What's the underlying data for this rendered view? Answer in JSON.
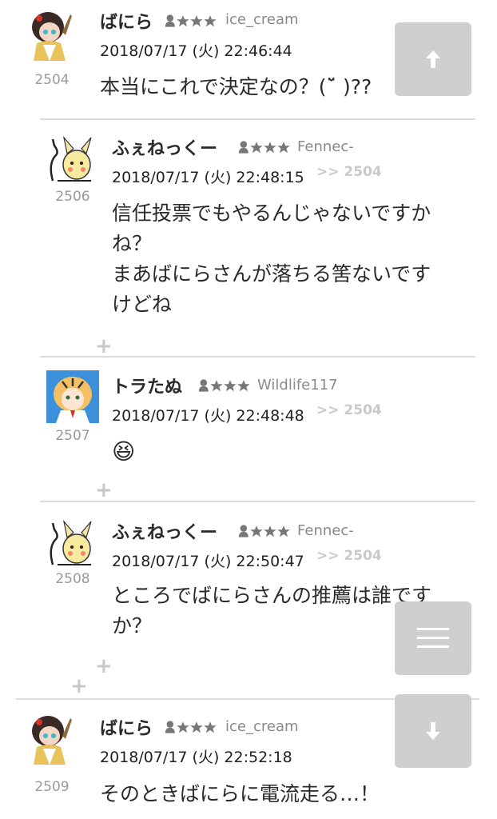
{
  "posts": [
    {
      "number": "2504",
      "name": "ばにら",
      "user_id": "ice_cream",
      "datetime": "2018/07/17 (火) 22:46:44",
      "reply_to": "",
      "lines": [
        "本当にこれで決定なの？(ˇ̈  )??"
      ],
      "avatar": "vanilla-avatar"
    },
    {
      "number": "2506",
      "name": "ふぇねっくー",
      "user_id": "Fennec-",
      "datetime": "2018/07/17 (火) 22:48:15",
      "reply_to": ">> 2504",
      "lines": [
        "信任投票でもやるんじゃないですか",
        "ね？",
        "まあばにらさんが落ちる筈ないです",
        "けどね"
      ],
      "avatar": "fennec-avatar"
    },
    {
      "number": "2507",
      "name": "トラたぬ",
      "user_id": "Wildlife117",
      "datetime": "2018/07/17 (火) 22:48:48",
      "reply_to": ">> 2504",
      "emoji": "😆",
      "avatar": "tiger-avatar"
    },
    {
      "number": "2508",
      "name": "ふぇねっくー",
      "user_id": "Fennec-",
      "datetime": "2018/07/17 (火) 22:50:47",
      "reply_to": ">> 2504",
      "lines": [
        "ところでばにらさんの推薦は誰です",
        "か？"
      ],
      "avatar": "fennec-avatar"
    },
    {
      "number": "2509",
      "name": "ばにら",
      "user_id": "ice_cream",
      "datetime": "2018/07/17 (火) 22:52:18",
      "reply_to": "",
      "lines": [
        "そのときばにらに電流走る…！"
      ],
      "avatar": "vanilla-avatar"
    }
  ],
  "controls": {
    "scroll_up_icon": "arrow-up-icon",
    "menu_icon": "hamburger-menu-icon",
    "scroll_down_icon": "arrow-down-icon",
    "expand_icon": "plus-icon"
  },
  "colors": {
    "fab_bg": "#cfcfcf",
    "divider": "#dcdcdc",
    "reply_link": "#c9c9c9",
    "number": "#9a9a9a"
  }
}
